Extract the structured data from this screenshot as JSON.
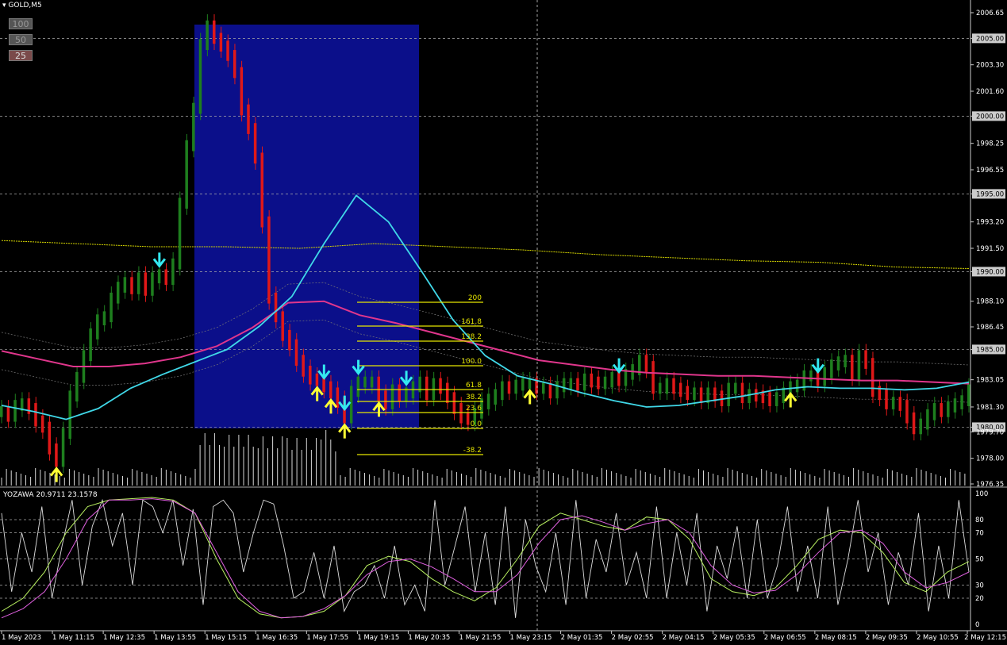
{
  "symbol_label": "GOLD,M5",
  "zoom_buttons": [
    "100",
    "50",
    "25"
  ],
  "oscillator_label": "YOZAWA 20.9711 23.1578",
  "colors": {
    "bull": "#1e7f1e",
    "bear": "#e01818",
    "fast_ma": "#40d8e8",
    "slow_ma": "#e0368c",
    "box": "#0b0f8a",
    "fib": "#e6e600",
    "arrow_up": "#ffff33",
    "arrow_down": "#33e8f0"
  },
  "chart_data": [
    {
      "type": "line",
      "panel": "price",
      "y_ticks": [
        "2006.65",
        "2005.00",
        "2003.30",
        "2001.60",
        "2000.00",
        "1998.25",
        "1996.55",
        "1995.00",
        "1993.20",
        "1991.50",
        "1990.00",
        "1988.10",
        "1986.45",
        "1985.00",
        "1983.05",
        "1981.30",
        "1980.00",
        "1979.70",
        "1978.00",
        "1976.35"
      ],
      "ylim": [
        1976.35,
        2006.65
      ],
      "highlighted_levels": [
        2005.0,
        2000.0,
        1995.0,
        1990.0,
        1985.0,
        1980.0
      ],
      "x_ticks": [
        "1 May 2023",
        "1 May 11:15",
        "1 May 12:35",
        "1 May 13:55",
        "1 May 15:15",
        "1 May 16:35",
        "1 May 17:55",
        "1 May 19:15",
        "1 May 20:35",
        "1 May 21:55",
        "1 May 23:15",
        "2 May 01:35",
        "2 May 02:55",
        "2 May 04:15",
        "2 May 05:35",
        "2 May 06:55",
        "2 May 08:15",
        "2 May 09:35",
        "2 May 10:55",
        "2 May 12:15"
      ],
      "series": [
        {
          "values": [
            1981.0,
            1980.7,
            1981.4,
            1981.5,
            1981.2,
            1980.4,
            1980.0,
            1978.6,
            1977.8,
            1979.6,
            1982.0,
            1983.2,
            1984.6,
            1986.0,
            1986.9,
            1987.1,
            1988.3,
            1989.0,
            1989.3,
            1988.9,
            1989.6,
            1988.8,
            1989.6,
            1989.8,
            1989.5,
            1990.5,
            1994.4,
            1998.1,
            2000.5,
            2004.6,
            2005.8,
            2005.0,
            2004.5,
            2003.9,
            2002.8,
            2000.4,
            1999.2,
            1997.3,
            1993.2,
            1988.3,
            1987.1,
            1985.9,
            1985.3,
            1984.3,
            1983.6,
            1983.1,
            1983.0,
            1982.6,
            1982.2,
            1981.6,
            1980.6,
            1982.3,
            1982.9,
            1982.9,
            1982.9,
            1982.0,
            1981.5,
            1982.4,
            1982.0,
            1982.2,
            1982.6,
            1982.9,
            1982.1,
            1982.8,
            1982.5,
            1981.9,
            1981.2,
            1980.6,
            1980.5,
            1980.9,
            1981.5,
            1981.8,
            1982.1,
            1982.6,
            1982.5,
            1982.7,
            1982.8,
            1982.8,
            1982.5,
            1982.5,
            1982.2,
            1982.6,
            1982.8,
            1982.8,
            1982.7,
            1983.1,
            1982.9,
            1982.8,
            1982.9,
            1983.2,
            1983.0,
            1983.4,
            1983.7,
            1984.3,
            1983.9,
            1982.5,
            1982.5,
            1982.8,
            1982.5,
            1982.3,
            1982.1,
            1982.2,
            1981.9,
            1982.2,
            1982.0,
            1981.7,
            1982.5,
            1982.5,
            1981.9,
            1982.1,
            1982.0,
            1981.9,
            1981.7,
            1981.9,
            1982.2,
            1982.6,
            1982.7,
            1983.3,
            1983.3,
            1983.0,
            1983.5,
            1984.0,
            1984.2,
            1984.3,
            1983.4,
            1984.6,
            1984.1,
            1982.3,
            1982.1,
            1981.5,
            1981.6,
            1981.4,
            1980.6,
            1979.9,
            1980.2,
            1980.8,
            1981.2,
            1981.0,
            1981.3,
            1981.5,
            1981.7,
            1982.4
          ]
        }
      ],
      "ma_fast": [
        1981.4,
        1981.0,
        1980.5,
        1981.2,
        1982.5,
        1983.4,
        1984.2,
        1985.0,
        1986.5,
        1988.4,
        1991.8,
        1994.9,
        1993.2,
        1990.1,
        1986.9,
        1984.6,
        1983.3,
        1982.8,
        1982.2,
        1981.7,
        1981.3,
        1981.4,
        1981.7,
        1982.0,
        1982.4,
        1982.6,
        1982.5,
        1982.5,
        1982.4,
        1982.5,
        1982.9
      ],
      "ma_slow": [
        1984.9,
        1984.4,
        1983.9,
        1983.9,
        1984.1,
        1984.5,
        1985.2,
        1986.4,
        1988.0,
        1988.1,
        1987.2,
        1986.7,
        1986.1,
        1985.5,
        1984.9,
        1984.3,
        1984.0,
        1983.7,
        1983.5,
        1983.4,
        1983.3,
        1983.3,
        1983.2,
        1983.1,
        1983.0,
        1983.0,
        1982.9,
        1982.8
      ],
      "ma_yellow": [
        1992.0,
        1991.8,
        1991.6,
        1991.6,
        1991.5,
        1991.8,
        1991.6,
        1991.4,
        1991.1,
        1990.9,
        1990.7,
        1990.6,
        1990.3,
        1990.2
      ],
      "fibonacci": {
        "levels": [
          "200",
          "161.8",
          "138.2",
          "100.0",
          "61.8",
          "38.2",
          "23.6",
          "0.0",
          "-38.2"
        ]
      },
      "signals": {
        "up": [
          8,
          46,
          48,
          50,
          55,
          77,
          115
        ],
        "down": [
          23,
          47,
          50,
          52,
          59,
          90,
          119
        ]
      }
    },
    {
      "type": "line",
      "panel": "oscillator",
      "y_ticks": [
        "100",
        "80",
        "70",
        "50",
        "30",
        "20",
        "0"
      ],
      "ylim": [
        0,
        100
      ],
      "levels": [
        80,
        70,
        50,
        30,
        20
      ],
      "series": [
        {
          "values": [
            85,
            25,
            70,
            40,
            90,
            20,
            60,
            95,
            30,
            75,
            95,
            60,
            85,
            30,
            95,
            90,
            70,
            95,
            45,
            88,
            15,
            90,
            95,
            85,
            40,
            70,
            95,
            92,
            60,
            20,
            25,
            55,
            20,
            60,
            10,
            25,
            30,
            45,
            20,
            60,
            15,
            30,
            10,
            95,
            30,
            60,
            90,
            25,
            70,
            15,
            90,
            5,
            80,
            45,
            25,
            70,
            15,
            95,
            20,
            65,
            40,
            85,
            30,
            55,
            20,
            90,
            20,
            70,
            30,
            85,
            10,
            60,
            35,
            75,
            20,
            80,
            20,
            45,
            90,
            25,
            60,
            20,
            90,
            15,
            50,
            95,
            40,
            70,
            15,
            55,
            30,
            85,
            10,
            60,
            20,
            95,
            40
          ]
        },
        {
          "values": [
            10,
            20,
            40,
            70,
            90,
            95,
            96,
            97,
            95,
            85,
            50,
            20,
            8,
            5,
            6,
            10,
            22,
            45,
            52,
            48,
            35,
            25,
            18,
            28,
            50,
            75,
            85,
            80,
            75,
            72,
            82,
            80,
            65,
            35,
            25,
            22,
            28,
            45,
            65,
            72,
            70,
            55,
            32,
            25,
            40,
            48
          ]
        },
        {
          "values": [
            5,
            12,
            25,
            50,
            80,
            95,
            95,
            96,
            94,
            85,
            55,
            25,
            10,
            5,
            6,
            12,
            22,
            38,
            48,
            50,
            44,
            35,
            25,
            25,
            38,
            62,
            80,
            83,
            78,
            72,
            77,
            80,
            70,
            45,
            30,
            24,
            26,
            38,
            55,
            70,
            72,
            62,
            40,
            28,
            32,
            40
          ]
        }
      ]
    }
  ]
}
